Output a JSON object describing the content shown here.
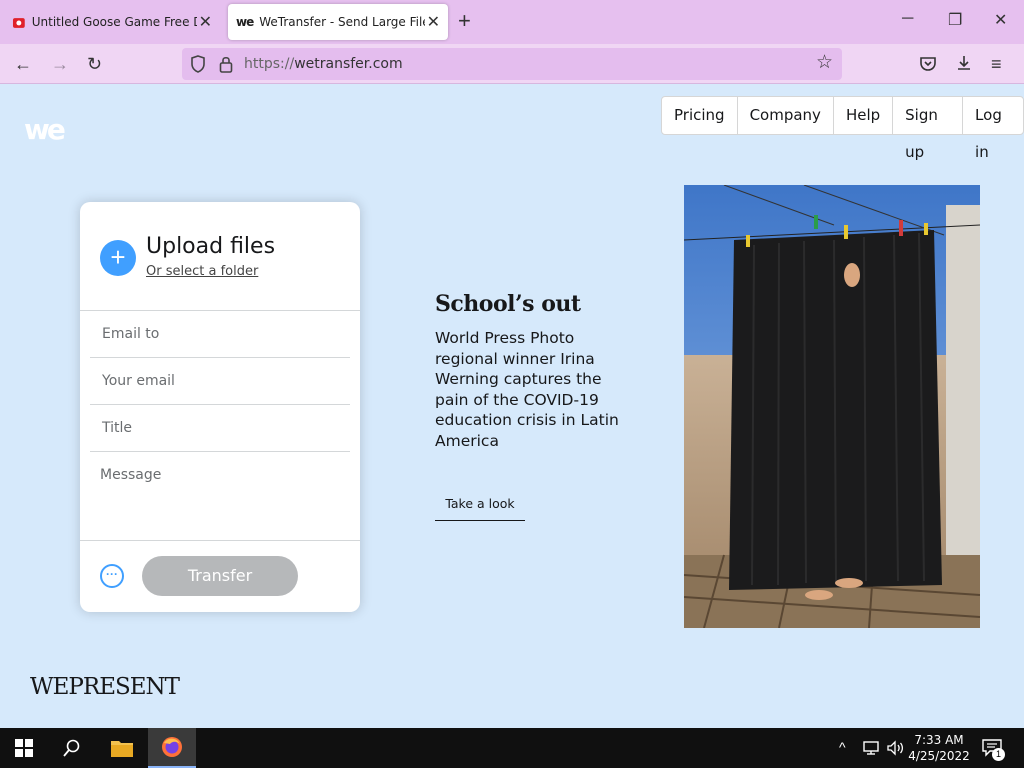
{
  "browser": {
    "tabs": [
      {
        "title": "Untitled Goose Game Free Down",
        "icon": "pdf-icon"
      },
      {
        "title": "WeTransfer - Send Large Files &",
        "icon": "wetransfer-favicon"
      }
    ],
    "url_scheme": "https://",
    "url_host": "wetransfer.com"
  },
  "site": {
    "logo_text": "we",
    "nav": [
      "Pricing",
      "Company",
      "Help",
      "Sign up",
      "Log in"
    ]
  },
  "upload": {
    "title": "Upload files",
    "folder_link": "Or select a folder",
    "email_to": "Email to",
    "your_email": "Your email",
    "title_field": "Title",
    "message": "Message",
    "transfer": "Transfer"
  },
  "story": {
    "title": "School’s out",
    "description": "World Press Photo regional winner Irina Werning captures the pain of the COVID-19 education crisis in Latin America",
    "cta": "Take a look"
  },
  "footer": {
    "brand": "WEPRESENT"
  },
  "taskbar": {
    "time": "7:33 AM",
    "date": "4/25/2022",
    "notifications": "1"
  },
  "colors": {
    "page_bg": "#d6e9fb",
    "accent_blue": "#409fff",
    "tabbar": "#e6c0ef"
  }
}
